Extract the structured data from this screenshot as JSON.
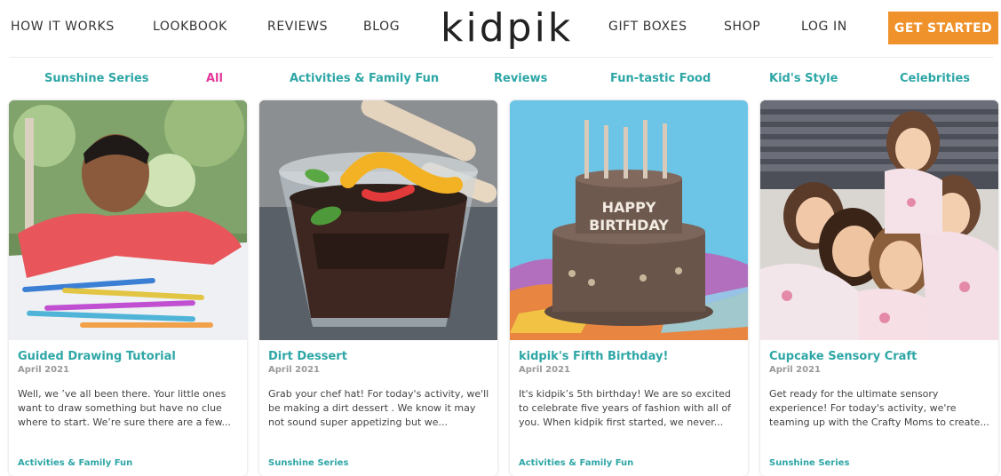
{
  "nav": {
    "left": [
      "HOW IT WORKS",
      "LOOKBOOK",
      "REVIEWS",
      "BLOG"
    ],
    "logo": "kidpik",
    "right": [
      "GIFT BOXES",
      "SHOP",
      "LOG IN"
    ],
    "cta": "GET STARTED"
  },
  "categories": [
    "Sunshine Series",
    "All",
    "Activities & Family Fun",
    "Reviews",
    "Fun-tastic Food",
    "Kid's Style",
    "Celebrities"
  ],
  "active_category": "All",
  "colors": {
    "accent": "#2ea6a6",
    "active": "#e3389a",
    "cta": "#f0922b"
  },
  "posts": [
    {
      "title": "Guided Drawing Tutorial",
      "date": "April 2021",
      "excerpt": "Well, we ’ve all been there. Your little ones want to draw something but have no clue where to start. We’re sure there are a few...",
      "tag": "Activities & Family Fun"
    },
    {
      "title": "Dirt Dessert",
      "date": "April 2021",
      "excerpt": "Grab your chef hat! For today's activity, we'll be making a dirt dessert . We know it may not sound super appetizing but we...",
      "tag": "Sunshine Series"
    },
    {
      "title": "kidpik's Fifth Birthday!",
      "date": "April 2021",
      "excerpt": "It's kidpik’s 5th birthday! We are so excited to celebrate five years of fashion with all of you. When kidpik first started, we never...",
      "tag": "Activities & Family Fun",
      "cake_text": [
        "HAPPY",
        "BIRTHDAY"
      ]
    },
    {
      "title": "Cupcake Sensory Craft",
      "date": "April 2021",
      "excerpt": "Get ready for the ultimate sensory experience! For today's activity, we're teaming up with the Crafty Moms to create...",
      "tag": "Sunshine Series"
    }
  ]
}
